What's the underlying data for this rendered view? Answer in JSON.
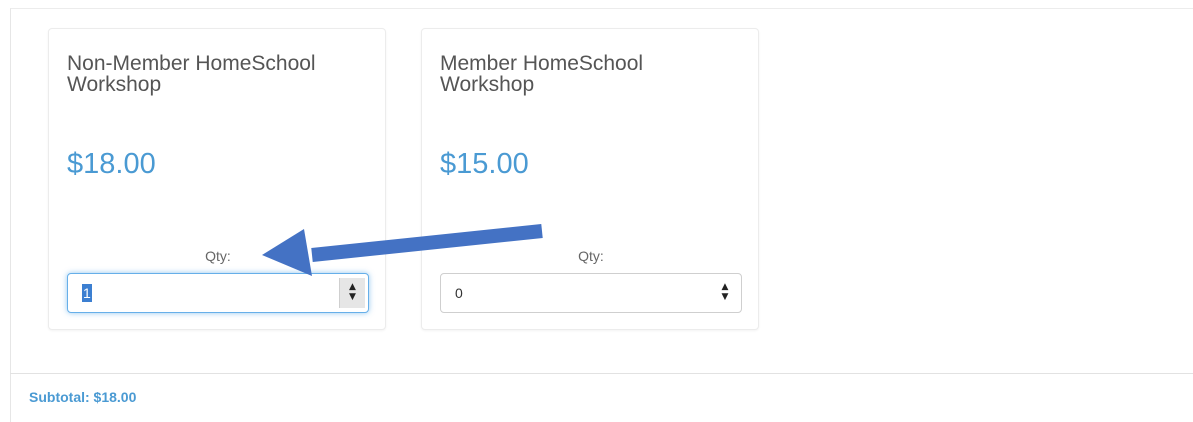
{
  "products": [
    {
      "title": "Non-Member HomeSchool Workshop",
      "price": "$18.00",
      "qty_label": "Qty:",
      "qty_value": "1",
      "qty_focused": true
    },
    {
      "title": "Member HomeSchool Workshop",
      "price": "$15.00",
      "qty_label": "Qty:",
      "qty_value": "0",
      "qty_focused": false
    }
  ],
  "subtotal": "Subtotal: $18.00",
  "icons": {
    "spinner_up": "triangle-up-icon",
    "spinner_down": "triangle-down-icon",
    "annotation": "arrow-icon"
  },
  "colors": {
    "price": "#4a9ad3",
    "subtotal": "#4a9ad3",
    "annotation_arrow": "#4472c4",
    "focus_ring": "#66afe9",
    "text_selection": "#3c7fd1"
  }
}
